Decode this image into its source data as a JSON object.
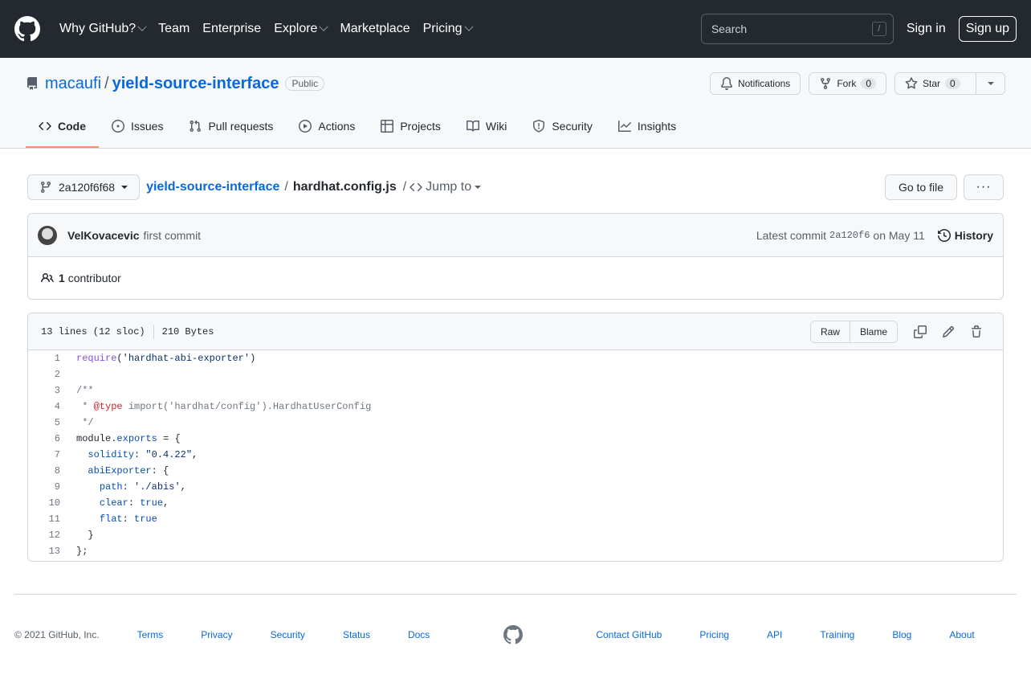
{
  "header": {
    "nav": [
      {
        "label": "Why GitHub?",
        "caret": true
      },
      {
        "label": "Team",
        "caret": false
      },
      {
        "label": "Enterprise",
        "caret": false
      },
      {
        "label": "Explore",
        "caret": true
      },
      {
        "label": "Marketplace",
        "caret": false
      },
      {
        "label": "Pricing",
        "caret": true
      }
    ],
    "search_placeholder": "Search",
    "search_key": "/",
    "sign_in": "Sign in",
    "sign_up": "Sign up"
  },
  "repo": {
    "owner": "macaufi",
    "separator": "/",
    "name": "yield-source-interface",
    "visibility": "Public",
    "notifications_label": "Notifications",
    "fork_label": "Fork",
    "fork_count": "0",
    "star_label": "Star",
    "star_count": "0"
  },
  "tabs": [
    {
      "label": "Code",
      "icon": "code-icon",
      "active": true
    },
    {
      "label": "Issues",
      "icon": "issue-icon",
      "active": false
    },
    {
      "label": "Pull requests",
      "icon": "pull-request-icon",
      "active": false
    },
    {
      "label": "Actions",
      "icon": "play-icon",
      "active": false
    },
    {
      "label": "Projects",
      "icon": "table-icon",
      "active": false
    },
    {
      "label": "Wiki",
      "icon": "book-icon",
      "active": false
    },
    {
      "label": "Security",
      "icon": "shield-icon",
      "active": false
    },
    {
      "label": "Insights",
      "icon": "graph-icon",
      "active": false
    }
  ],
  "file_nav": {
    "branch": "2a120f6f68",
    "repo_crumb": "yield-source-interface",
    "crumb_sep": "/",
    "file_name": "hardhat.config.js",
    "jump_sep": "/",
    "jump_to": "Jump to",
    "go_to_file": "Go to file"
  },
  "commit": {
    "author": "VelKovacevic",
    "message": "first commit",
    "latest_prefix": "Latest commit",
    "sha": "2a120f6",
    "date": "on May 11",
    "history": "History",
    "contributor_count": "1",
    "contributor_label": "contributor"
  },
  "file": {
    "lines_info": "13 lines (12 sloc)",
    "size": "210 Bytes",
    "raw": "Raw",
    "blame": "Blame"
  },
  "code_lines": [
    [
      [
        "k",
        "require"
      ],
      [
        "",
        "("
      ],
      [
        "s",
        "'hardhat-abi-exporter'"
      ],
      [
        "",
        ")"
      ]
    ],
    [],
    [
      [
        "c",
        "/**"
      ]
    ],
    [
      [
        "c",
        " * "
      ],
      [
        "d",
        "@type"
      ],
      [
        "c",
        " import('hardhat/config').HardhatUserConfig"
      ]
    ],
    [
      [
        "c",
        " */"
      ]
    ],
    [
      [
        "",
        "module."
      ],
      [
        "p",
        "exports"
      ],
      [
        "",
        " = {"
      ]
    ],
    [
      [
        "",
        "  "
      ],
      [
        "p",
        "solidity"
      ],
      [
        "",
        ": "
      ],
      [
        "s",
        "\"0.4.22\""
      ],
      [
        "",
        ","
      ]
    ],
    [
      [
        "",
        "  "
      ],
      [
        "p",
        "abiExporter"
      ],
      [
        "",
        ": {"
      ]
    ],
    [
      [
        "",
        "    "
      ],
      [
        "p",
        "path"
      ],
      [
        "",
        ": "
      ],
      [
        "s",
        "'./abis'"
      ],
      [
        "",
        ","
      ]
    ],
    [
      [
        "",
        "    "
      ],
      [
        "p",
        "clear"
      ],
      [
        "",
        ": "
      ],
      [
        "p",
        "true"
      ],
      [
        "",
        ","
      ]
    ],
    [
      [
        "",
        "    "
      ],
      [
        "p",
        "flat"
      ],
      [
        "",
        ": "
      ],
      [
        "p",
        "true"
      ]
    ],
    [
      [
        "",
        "  }"
      ]
    ],
    [
      [
        "",
        "};"
      ]
    ]
  ],
  "footer": {
    "copyright": "© 2021 GitHub, Inc.",
    "left_links": [
      "Terms",
      "Privacy",
      "Security",
      "Status",
      "Docs"
    ],
    "right_links": [
      "Contact GitHub",
      "Pricing",
      "API",
      "Training",
      "Blog",
      "About"
    ]
  }
}
